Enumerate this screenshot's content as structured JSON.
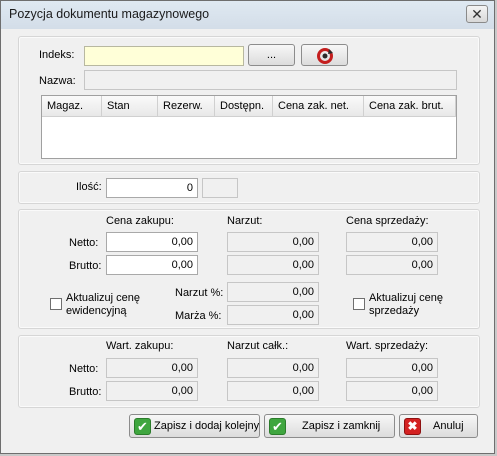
{
  "window": {
    "title": "Pozycja dokumentu magazynowego",
    "close_glyph": "✕"
  },
  "item": {
    "index_label": "Indeks:",
    "index_value": "",
    "browse_label": "...",
    "refresh_icon": "refresh-icon",
    "name_label": "Nazwa:",
    "name_value": ""
  },
  "stock_table": {
    "columns": [
      "Magaz.",
      "Stan",
      "Rezerw.",
      "Dostępn.",
      "Cena zak. net.",
      "Cena zak. brut."
    ],
    "rows": []
  },
  "quantity": {
    "label": "Ilość:",
    "value": "0",
    "unit": ""
  },
  "prices": {
    "purchase_header": "Cena zakupu:",
    "markup_header": "Narzut:",
    "sale_header": "Cena sprzedaży:",
    "net_label": "Netto:",
    "gross_label": "Brutto:",
    "purchase_net": "0,00",
    "purchase_gross": "0,00",
    "markup_net": "0,00",
    "markup_gross": "0,00",
    "sale_net": "0,00",
    "sale_gross": "0,00",
    "update_record_price": "Aktualizuj cenę ewidencyjną",
    "update_sale_price": "Aktualizuj cenę sprzedaży",
    "markup_pct_label": "Narzut %:",
    "markup_pct": "0,00",
    "margin_pct_label": "Marża %:",
    "margin_pct": "0,00"
  },
  "values": {
    "purchase_header": "Wart. zakupu:",
    "markup_header": "Narzut całk.:",
    "sale_header": "Wart. sprzedaży:",
    "net_label": "Netto:",
    "gross_label": "Brutto:",
    "purchase_net": "0,00",
    "purchase_gross": "0,00",
    "markup_net": "0,00",
    "markup_gross": "0,00",
    "sale_net": "0,00",
    "sale_gross": "0,00"
  },
  "buttons": {
    "save_add": "Zapisz i dodaj kolejny",
    "save_close": "Zapisz i zamknij",
    "cancel": "Anuluj",
    "ok_glyph": "✔",
    "cancel_glyph": "✖"
  },
  "colors": {
    "index_field": "#ffffd8",
    "ok_icon": "#3fa63f",
    "cancel_icon": "#d42222"
  }
}
